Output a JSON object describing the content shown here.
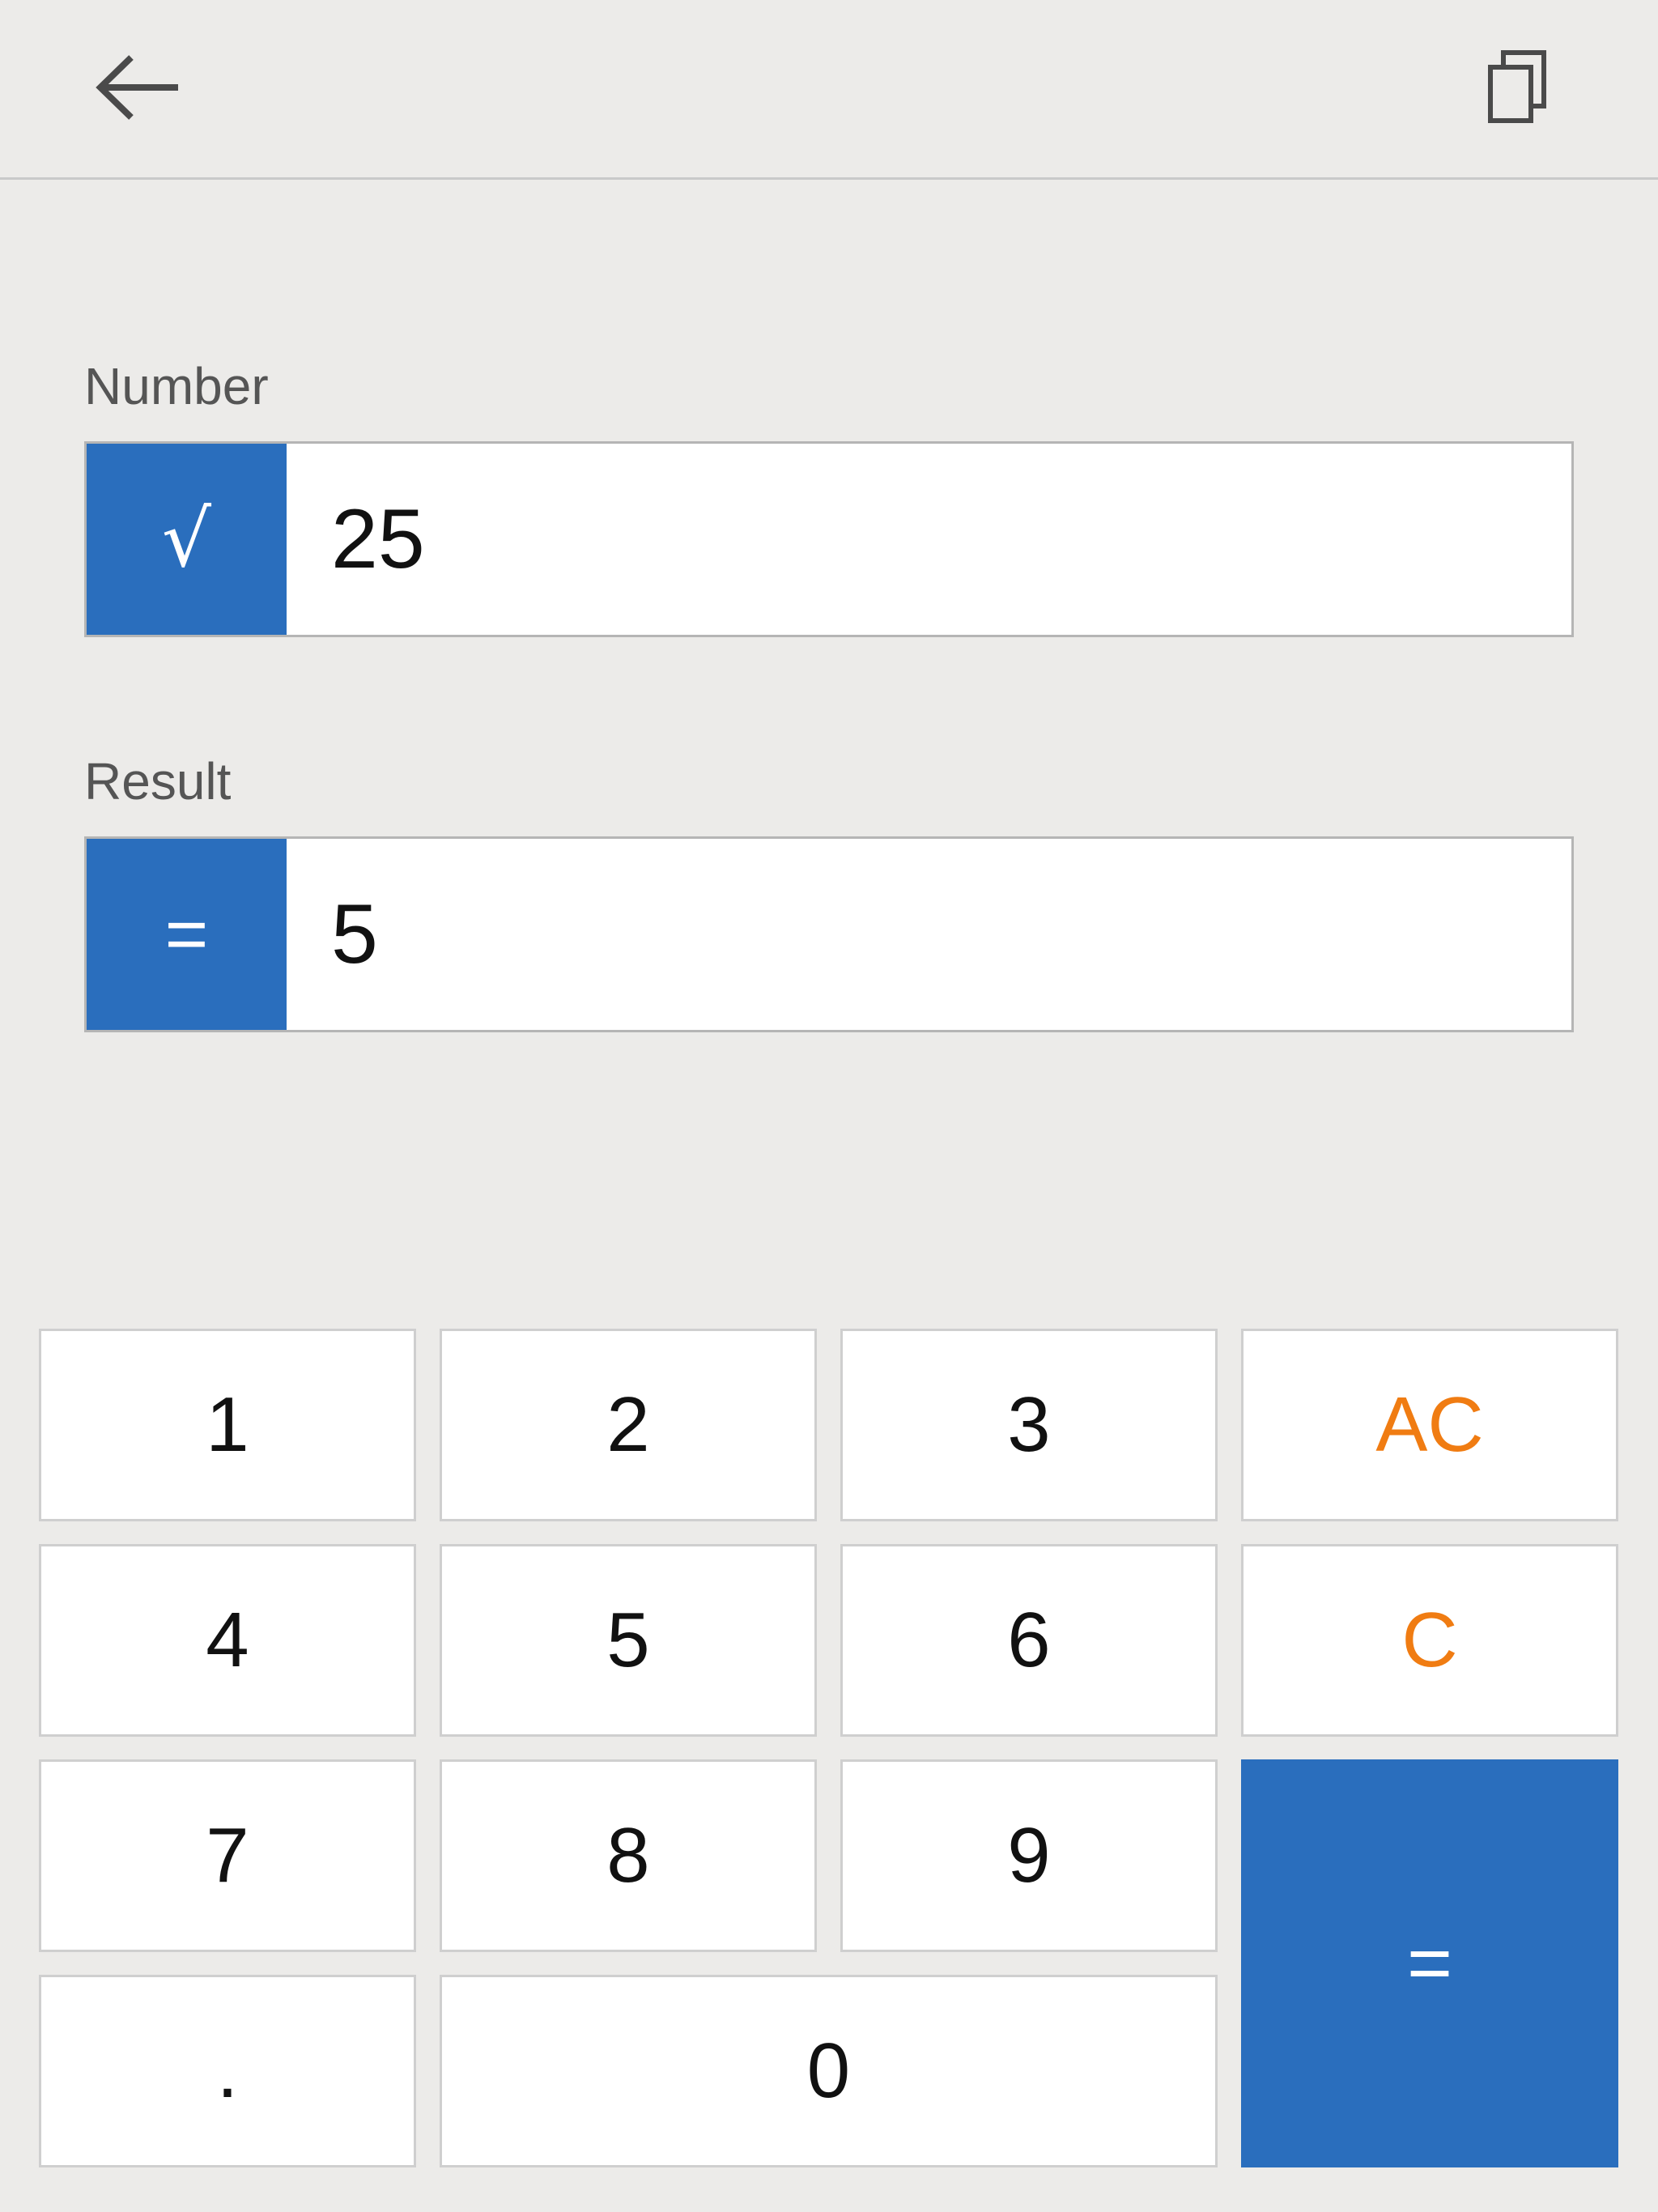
{
  "header": {
    "back_icon": "arrow-left-icon",
    "copy_icon": "copy-icon"
  },
  "number_field": {
    "label": "Number",
    "operator": "√",
    "value": "25"
  },
  "result_field": {
    "label": "Result",
    "operator": "=",
    "value": "5"
  },
  "keypad": {
    "k1": "1",
    "k2": "2",
    "k3": "3",
    "ac": "AC",
    "k4": "4",
    "k5": "5",
    "k6": "6",
    "c": "C",
    "k7": "7",
    "k8": "8",
    "k9": "9",
    "equals": "=",
    "dot": ".",
    "k0": "0"
  },
  "colors": {
    "accent": "#2a6ebd",
    "clear_text": "#f07c12",
    "background": "#ecebe9"
  }
}
